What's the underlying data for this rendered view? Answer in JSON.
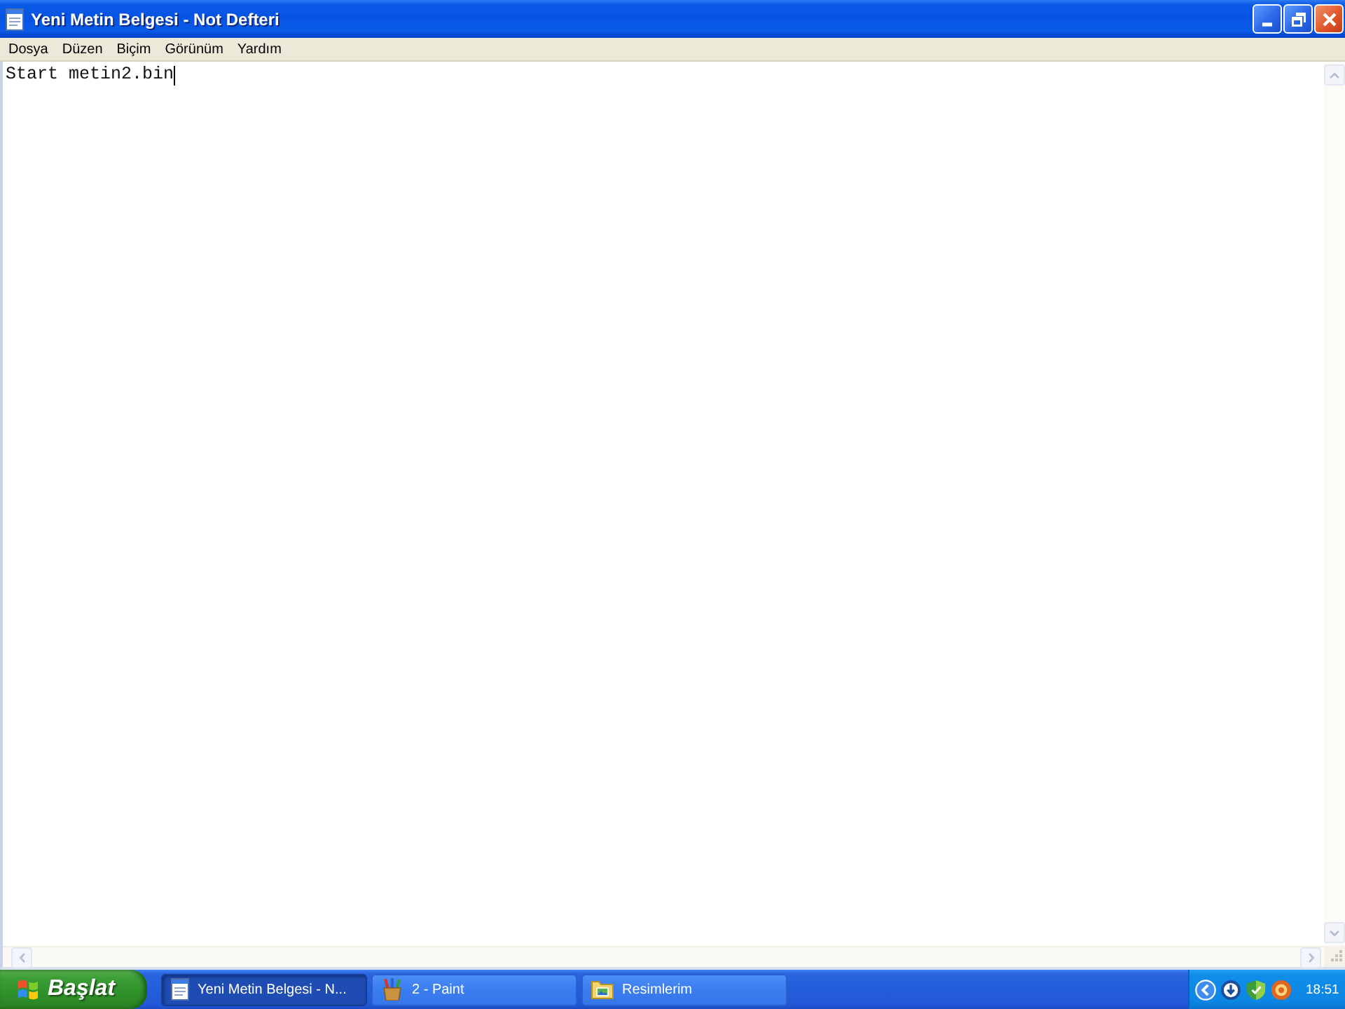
{
  "window": {
    "title": "Yeni Metin Belgesi - Not Defteri"
  },
  "menu": [
    "Dosya",
    "Düzen",
    "Biçim",
    "Görünüm",
    "Yardım"
  ],
  "editor": {
    "value": "Start metin2.bin"
  },
  "taskbar": {
    "start": "Başlat",
    "tasks": [
      {
        "label": "Yeni Metin Belgesi - N...",
        "kind": "notepad",
        "selected": true
      },
      {
        "label": "2 - Paint",
        "kind": "paint",
        "selected": false
      },
      {
        "label": "Resimlerim",
        "kind": "folder",
        "selected": false
      }
    ],
    "clock": "18:51"
  }
}
